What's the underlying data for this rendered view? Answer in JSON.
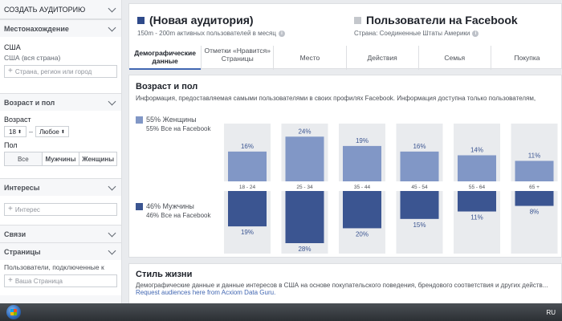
{
  "sidebar": {
    "title": "СОЗДАТЬ АУДИТОРИЮ",
    "location": {
      "header": "Местонахождение",
      "country": "США",
      "subtitle": "США (вся страна)",
      "placeholder": "Страна, регион или город"
    },
    "age_gender": {
      "header": "Возраст и пол",
      "age_label": "Возраст",
      "age_from": "18",
      "age_to": "Любое",
      "gender_label": "Пол",
      "gender_options": [
        "Все",
        "Мужчины",
        "Женщины"
      ]
    },
    "interests": {
      "header": "Интересы",
      "placeholder": "Интерес"
    },
    "connections": {
      "header": "Связи"
    },
    "pages": {
      "header": "Страницы"
    },
    "connected_pages": {
      "header": "Пользователи, подключенные к",
      "placeholder": "Ваша Страница"
    }
  },
  "header": {
    "audience1": {
      "title": "(Новая аудитория)",
      "subtitle": "150m - 200m активных пользователей в месяц",
      "color": "#2f4a8a"
    },
    "audience2": {
      "title": "Пользователи на Facebook",
      "subtitle": "Страна: Соединенные Штаты Америки",
      "color": "#c4c7cc"
    },
    "tabs": [
      {
        "label": "Демографические данные"
      },
      {
        "label": "Отметки «Нравится» Страницы"
      },
      {
        "label": "Место"
      },
      {
        "label": "Действия"
      },
      {
        "label": "Семья"
      },
      {
        "label": "Покупка"
      }
    ]
  },
  "age_gender_panel": {
    "title": "Возраст и пол",
    "description": "Информация, предоставляемая самыми пользователями в своих профилях Facebook. Информация доступна только пользователям,",
    "women": {
      "label": "55% Женщины",
      "sub": "55% Все на Facebook",
      "color": "#8197c6"
    },
    "men": {
      "label": "46% Мужчины",
      "sub": "46% Все на Facebook",
      "color": "#3b5591"
    }
  },
  "chart_data": {
    "type": "bar",
    "categories": [
      "18 - 24",
      "25 - 34",
      "35 - 44",
      "45 - 54",
      "55 - 64",
      "65 +"
    ],
    "series": [
      {
        "name": "Женщины",
        "values": [
          16,
          24,
          19,
          16,
          14,
          11
        ],
        "labels": [
          "16%",
          "24%",
          "19%",
          "16%",
          "14%",
          "11%"
        ]
      },
      {
        "name": "Мужчины",
        "values": [
          19,
          28,
          20,
          15,
          11,
          8
        ],
        "labels": [
          "19%",
          "28%",
          "20%",
          "15%",
          "11%",
          "8%"
        ]
      }
    ]
  },
  "lifestyle_panel": {
    "title": "Стиль жизни",
    "description": "Демографические данные и данные интересов в США на основе покупательского поведения, брендового соответствия и других действ...",
    "link": "Request audiences here from Acxiom Data Guru."
  },
  "taskbar": {
    "language": "RU"
  }
}
